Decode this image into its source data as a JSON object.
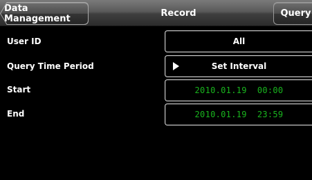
{
  "header": {
    "back_label": "Data Management",
    "title": "Record",
    "query_label": "Query"
  },
  "form": {
    "rows": [
      {
        "label": "User ID",
        "value": "All"
      },
      {
        "label": "Query Time Period",
        "value": "Set Interval",
        "icon": "play-icon"
      },
      {
        "label": "Start",
        "value": "2010.01.19  00:00"
      },
      {
        "label": "End",
        "value": "2010.01.19  23:59"
      }
    ]
  },
  "colors": {
    "date_text": "#19b51e",
    "background": "#000000"
  }
}
